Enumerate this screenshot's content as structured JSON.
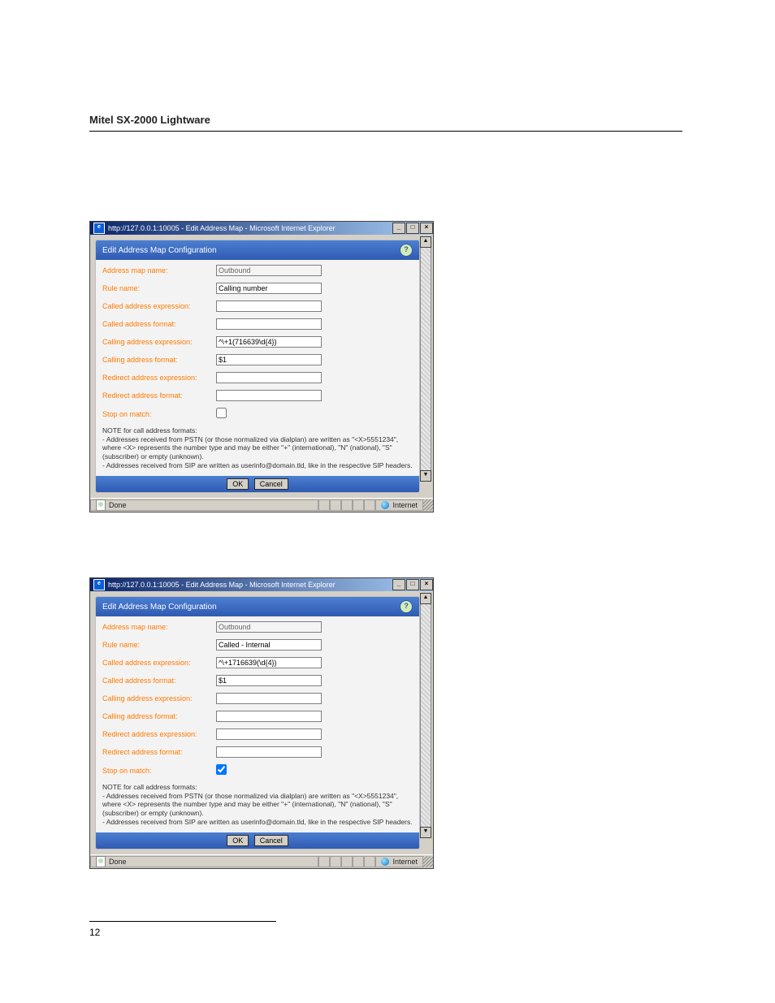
{
  "document": {
    "header": "Mitel SX-2000 Lightware",
    "page_number": "12"
  },
  "windows": [
    {
      "title": "http://127.0.0.1:10005 - Edit Address Map - Microsoft Internet Explorer",
      "panel_title": "Edit Address Map Configuration",
      "help_badge": "?",
      "fields": {
        "address_map_name": {
          "label": "Address map name:",
          "value": "Outbound",
          "readonly": true
        },
        "rule_name": {
          "label": "Rule name:",
          "value": "Calling number",
          "readonly": false
        },
        "called_addr_expr": {
          "label": "Called address expression:",
          "value": "",
          "readonly": false
        },
        "called_addr_fmt": {
          "label": "Called address format:",
          "value": "",
          "readonly": false
        },
        "calling_addr_expr": {
          "label": "Calling address expression:",
          "value": "^\\+1(716639\\d{4})",
          "readonly": false
        },
        "calling_addr_fmt": {
          "label": "Calling address format:",
          "value": "$1",
          "readonly": false
        },
        "redirect_addr_expr": {
          "label": "Redirect address expression:",
          "value": "",
          "readonly": false
        },
        "redirect_addr_fmt": {
          "label": "Redirect address format:",
          "value": "",
          "readonly": false
        },
        "stop_on_match": {
          "label": "Stop on match:",
          "checked": false
        }
      },
      "note": "NOTE for call address formats:\n- Addresses received from PSTN (or those normalized via dialplan) are written as \"<X>5551234\", where <X> represents the number type and may be either \"+\" (international), \"N\" (national), \"S\" (subscriber) or empty (unknown).\n- Addresses received from SIP are written as userinfo@domain.tld, like in the respective SIP headers.",
      "buttons": {
        "ok": "OK",
        "cancel": "Cancel"
      },
      "status": {
        "done": "Done",
        "zone": "Internet"
      }
    },
    {
      "title": "http://127.0.0.1:10005 - Edit Address Map - Microsoft Internet Explorer",
      "panel_title": "Edit Address Map Configuration",
      "help_badge": "?",
      "fields": {
        "address_map_name": {
          "label": "Address map name:",
          "value": "Outbound",
          "readonly": true
        },
        "rule_name": {
          "label": "Rule name:",
          "value": "Called - Internal",
          "readonly": false
        },
        "called_addr_expr": {
          "label": "Called address expression:",
          "value": "^\\+1716639(\\d{4})",
          "readonly": false
        },
        "called_addr_fmt": {
          "label": "Called address format:",
          "value": "$1",
          "readonly": false
        },
        "calling_addr_expr": {
          "label": "Calling address expression:",
          "value": "",
          "readonly": false
        },
        "calling_addr_fmt": {
          "label": "Calling address format:",
          "value": "",
          "readonly": false
        },
        "redirect_addr_expr": {
          "label": "Redirect address expression:",
          "value": "",
          "readonly": false
        },
        "redirect_addr_fmt": {
          "label": "Redirect address format:",
          "value": "",
          "readonly": false
        },
        "stop_on_match": {
          "label": "Stop on match:",
          "checked": true
        }
      },
      "note": "NOTE for call address formats:\n- Addresses received from PSTN (or those normalized via dialplan) are written as \"<X>5551234\", where <X> represents the number type and may be either \"+\" (international), \"N\" (national), \"S\" (subscriber) or empty (unknown).\n- Addresses received from SIP are written as userinfo@domain.tld, like in the respective SIP headers.",
      "buttons": {
        "ok": "OK",
        "cancel": "Cancel"
      },
      "status": {
        "done": "Done",
        "zone": "Internet"
      }
    }
  ]
}
